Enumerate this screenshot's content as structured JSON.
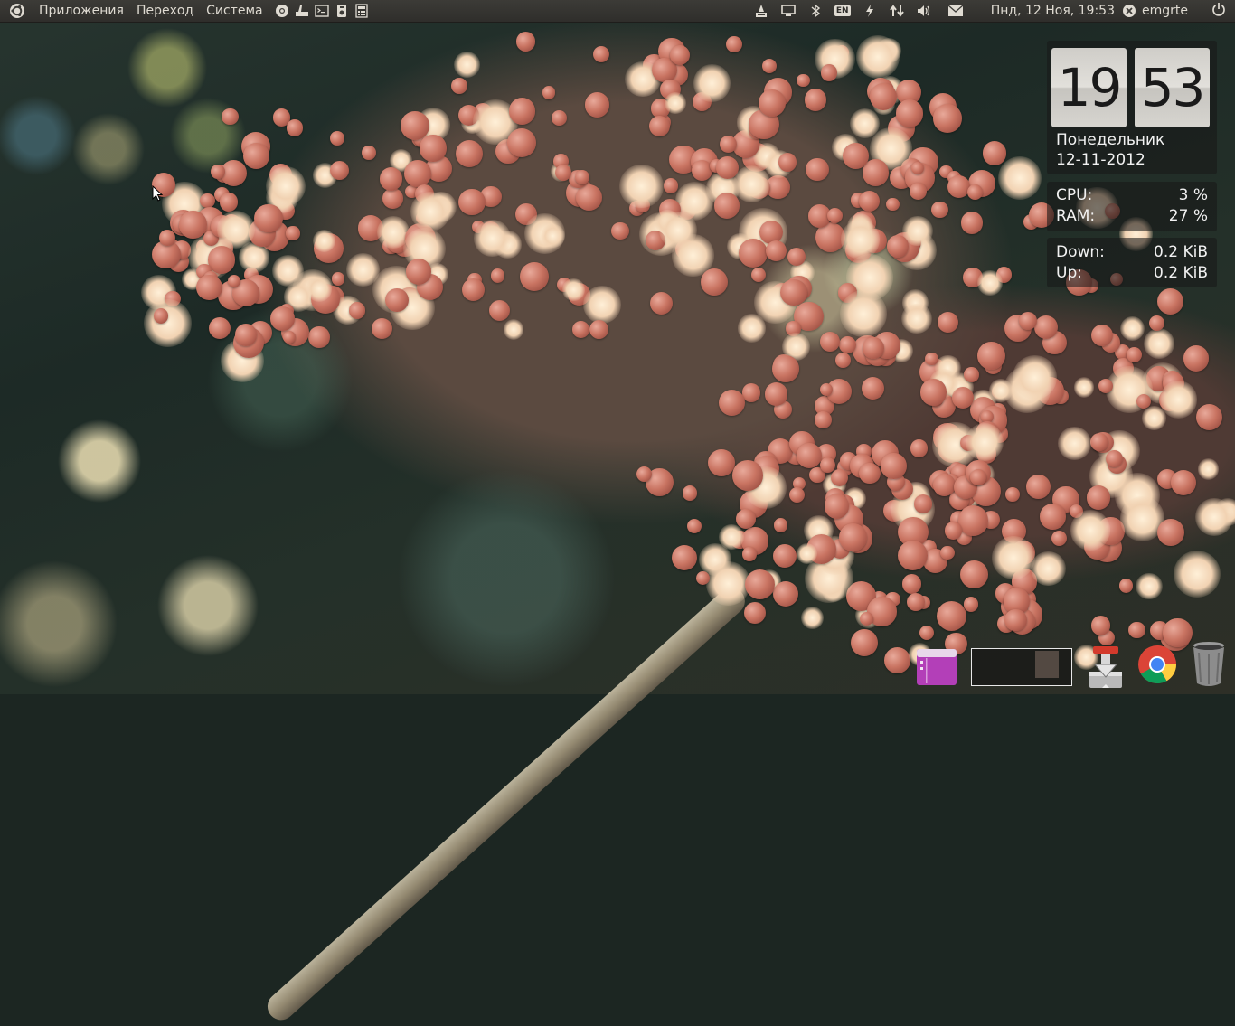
{
  "top_panel": {
    "menus": [
      "Приложения",
      "Переход",
      "Система"
    ],
    "launchers": [
      "chromium-icon",
      "scanner-icon",
      "terminal-icon",
      "media-player-icon",
      "calculator-icon"
    ],
    "tray_icons": [
      "update-manager-icon",
      "display-icon",
      "bluetooth-icon",
      "keyboard-layout-indicator",
      "power-icon",
      "network-icon",
      "volume-icon",
      "mail-icon"
    ],
    "keyboard_layout": "EN",
    "datetime": "Пнд, 12 Ноя, 19:53",
    "user": "emgrte"
  },
  "conky": {
    "hour": "19",
    "minute": "53",
    "weekday": "Понедельник",
    "date": "12-11-2012",
    "cpu_label": "CPU:",
    "cpu_value": "3 %",
    "ram_label": "RAM:",
    "ram_value": "27 %",
    "down_label": "Down:",
    "down_value": "0.2 KiB",
    "up_label": "Up:",
    "up_value": "0.2 KiB"
  },
  "dock": {
    "items": [
      "file-manager-icon",
      "window-preview",
      "download-manager-icon",
      "chrome-icon",
      "trash-icon"
    ]
  },
  "colors": {
    "panel_bg": "#3c3b37",
    "panel_text": "#dfdbd2",
    "conky_bg": "#181818"
  }
}
